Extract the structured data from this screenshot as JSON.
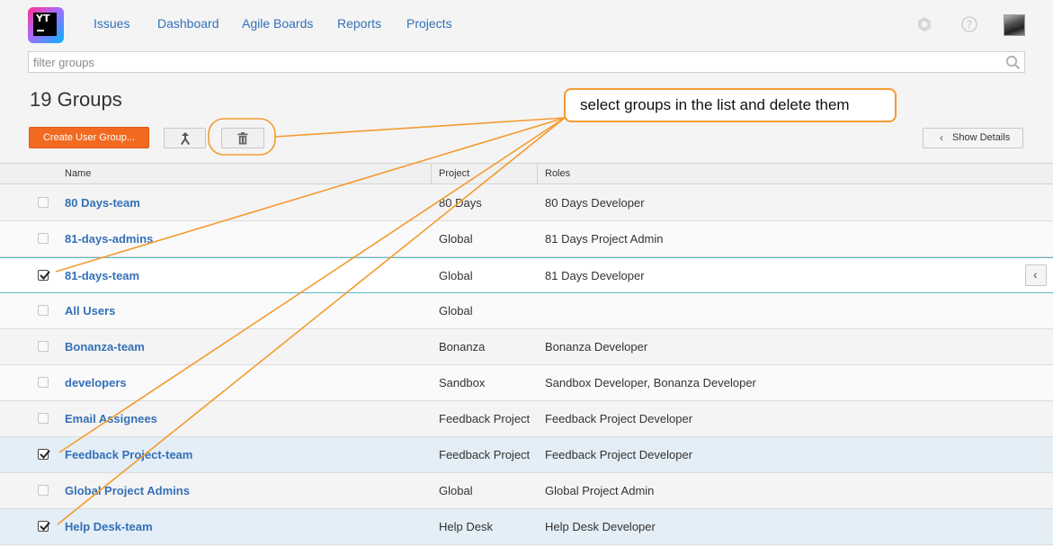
{
  "nav": {
    "items": [
      "Issues",
      "Dashboard",
      "Agile Boards",
      "Reports",
      "Projects"
    ]
  },
  "logo": {
    "text": "YT"
  },
  "icons": {
    "settings": "gear-icon",
    "help": "help-icon",
    "search": "search-icon",
    "merge": "merge-icon",
    "delete": "trash-icon"
  },
  "search": {
    "placeholder": "filter groups"
  },
  "page": {
    "title": "19 Groups"
  },
  "toolbar": {
    "create_label": "Create User Group...",
    "details_label": "Show Details"
  },
  "table": {
    "columns": [
      "Name",
      "Project",
      "Roles"
    ],
    "rows": [
      {
        "name": "80 Days-team",
        "project": "80 Days",
        "roles": "80 Days Developer",
        "checked": false
      },
      {
        "name": "81-days-admins",
        "project": "Global",
        "roles": "81 Days Project Admin",
        "checked": false
      },
      {
        "name": "81-days-team",
        "project": "Global",
        "roles": "81 Days Developer",
        "checked": true
      },
      {
        "name": "All Users",
        "project": "Global",
        "roles": "",
        "checked": false
      },
      {
        "name": "Bonanza-team",
        "project": "Bonanza",
        "roles": "Bonanza Developer",
        "checked": false
      },
      {
        "name": "developers",
        "project": "Sandbox",
        "roles": "Sandbox Developer, Bonanza Developer",
        "checked": false
      },
      {
        "name": "Email Assignees",
        "project": "Feedback Project",
        "roles": "Feedback Project Developer",
        "checked": false
      },
      {
        "name": "Feedback Project-team",
        "project": "Feedback Project",
        "roles": "Feedback Project Developer",
        "checked": true
      },
      {
        "name": "Global Project Admins",
        "project": "Global",
        "roles": "Global Project Admin",
        "checked": false
      },
      {
        "name": "Help Desk-team",
        "project": "Help Desk",
        "roles": "Help Desk Developer",
        "checked": true
      }
    ]
  },
  "annotation": {
    "text": "select groups in the list and delete them"
  },
  "colors": {
    "accent": "#f26a20",
    "link": "#3470b8",
    "annotation": "#f39b2f"
  }
}
